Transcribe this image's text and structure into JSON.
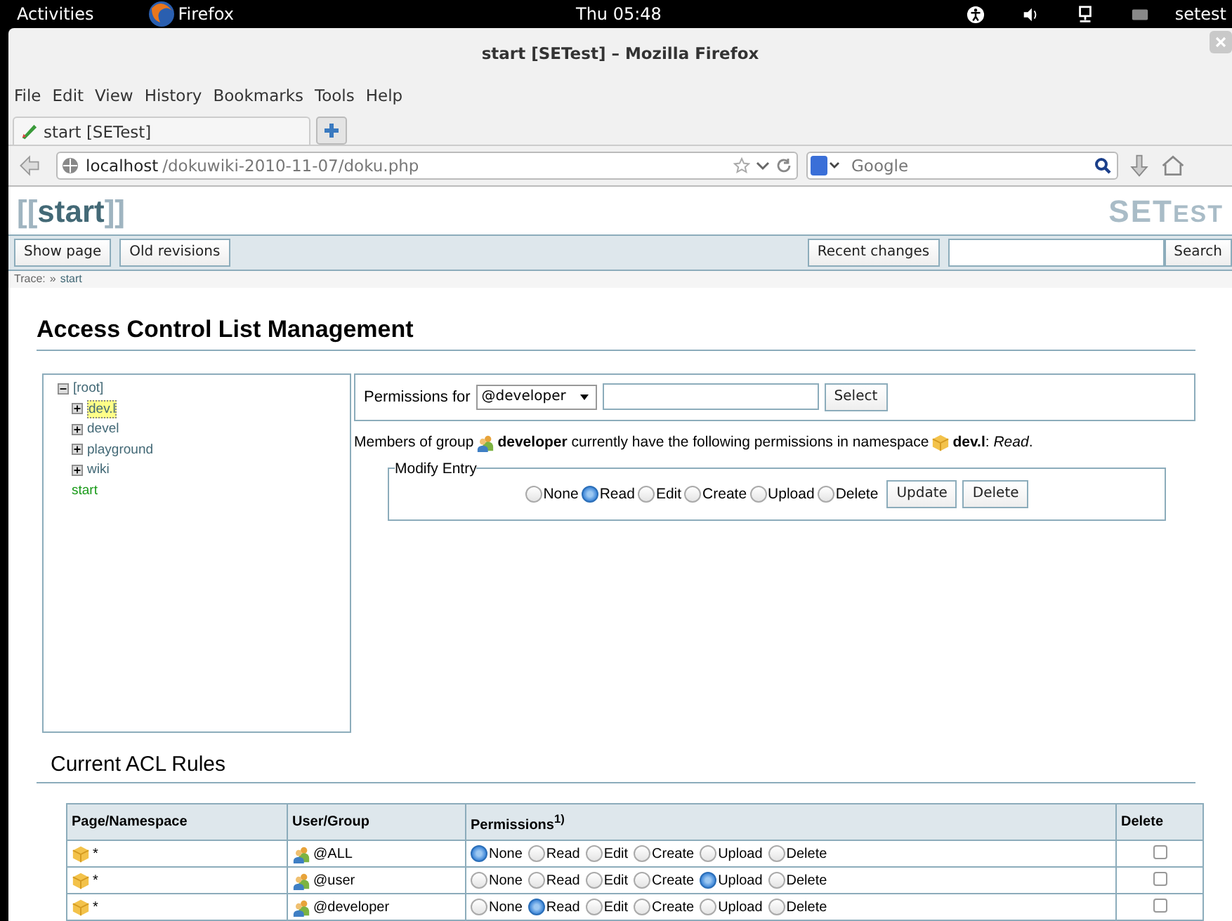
{
  "top_bar": {
    "activities": "Activities",
    "app": "Firefox",
    "clock": "Thu 05:48",
    "user": "setest"
  },
  "window": {
    "title": "start [SETest] – Mozilla Firefox"
  },
  "menu": [
    "File",
    "Edit",
    "View",
    "History",
    "Bookmarks",
    "Tools",
    "Help"
  ],
  "tabs": [
    {
      "label": "start [SETest]",
      "selected": true
    }
  ],
  "nav": {
    "url_host": "localhost",
    "url_path": "/dokuwiki-2010-11-07/doku.php",
    "search_placeholder": "Google"
  },
  "wiki": {
    "logo_open": "[[",
    "logo_title": "start",
    "logo_close": "]]",
    "brand_main": "SET",
    "brand_small": "EST",
    "left_buttons": [
      "Show page",
      "Old revisions"
    ],
    "recent_button": "Recent changes",
    "search_button": "Search",
    "trace_label": "Trace:",
    "trace_sep": "»",
    "trace_link": "start"
  },
  "heading": "Access Control List Management",
  "tree": {
    "label": "[root]",
    "expanded": true,
    "children": [
      {
        "label": "dev.l",
        "kind": "namespace",
        "selected": true
      },
      {
        "label": "devel",
        "kind": "namespace",
        "selected": false
      },
      {
        "label": "playground",
        "kind": "namespace",
        "selected": false
      },
      {
        "label": "wiki",
        "kind": "namespace",
        "selected": false
      },
      {
        "label": "start",
        "kind": "page",
        "selected": false
      }
    ]
  },
  "permissions_for": {
    "label": "Permissions for",
    "select_value": "@developer",
    "select_button": "Select"
  },
  "message": {
    "part_1": "Members of group",
    "part_2": "**developer** currently have the following permissions in namespace",
    "part_3": "**dev.l**: *Read*."
  },
  "modify_entry": {
    "legend": "Modify Entry",
    "options": [
      {
        "label": "None",
        "selected": false
      },
      {
        "label": "Read",
        "selected": true
      },
      {
        "label": "Edit",
        "selected": false
      },
      {
        "label": "Create",
        "selected": false
      },
      {
        "label": "Upload",
        "selected": false
      },
      {
        "label": "Delete",
        "selected": false
      }
    ],
    "buttons": [
      "Update",
      "Delete"
    ]
  },
  "rules": {
    "title": "Current ACL Rules",
    "columns": [
      "Page/Namespace",
      "User/Group",
      "Permissions$^{1)}$",
      "Delete"
    ],
    "rows": [
      {
        "page": "*",
        "user": "@ALL",
        "delete_checked": false,
        "permissions": [
          {
            "label": "None",
            "selected": true
          },
          {
            "label": "Read",
            "selected": false
          },
          {
            "label": "Edit",
            "selected": false
          },
          {
            "label": "Create",
            "selected": false
          },
          {
            "label": "Upload",
            "selected": false
          },
          {
            "label": "Delete",
            "selected": false
          }
        ]
      },
      {
        "page": "*",
        "user": "@user",
        "delete_checked": false,
        "permissions": [
          {
            "label": "None",
            "selected": false
          },
          {
            "label": "Read",
            "selected": false
          },
          {
            "label": "Edit",
            "selected": false
          },
          {
            "label": "Create",
            "selected": false
          },
          {
            "label": "Upload",
            "selected": true
          },
          {
            "label": "Delete",
            "selected": false
          }
        ]
      },
      {
        "page": "*",
        "user": "@developer",
        "delete_checked": false,
        "permissions": [
          {
            "label": "None",
            "selected": false
          },
          {
            "label": "Read",
            "selected": true
          },
          {
            "label": "Edit",
            "selected": false
          },
          {
            "label": "Create",
            "selected": false
          },
          {
            "label": "Upload",
            "selected": false
          },
          {
            "label": "Delete",
            "selected": false
          }
        ]
      }
    ]
  }
}
